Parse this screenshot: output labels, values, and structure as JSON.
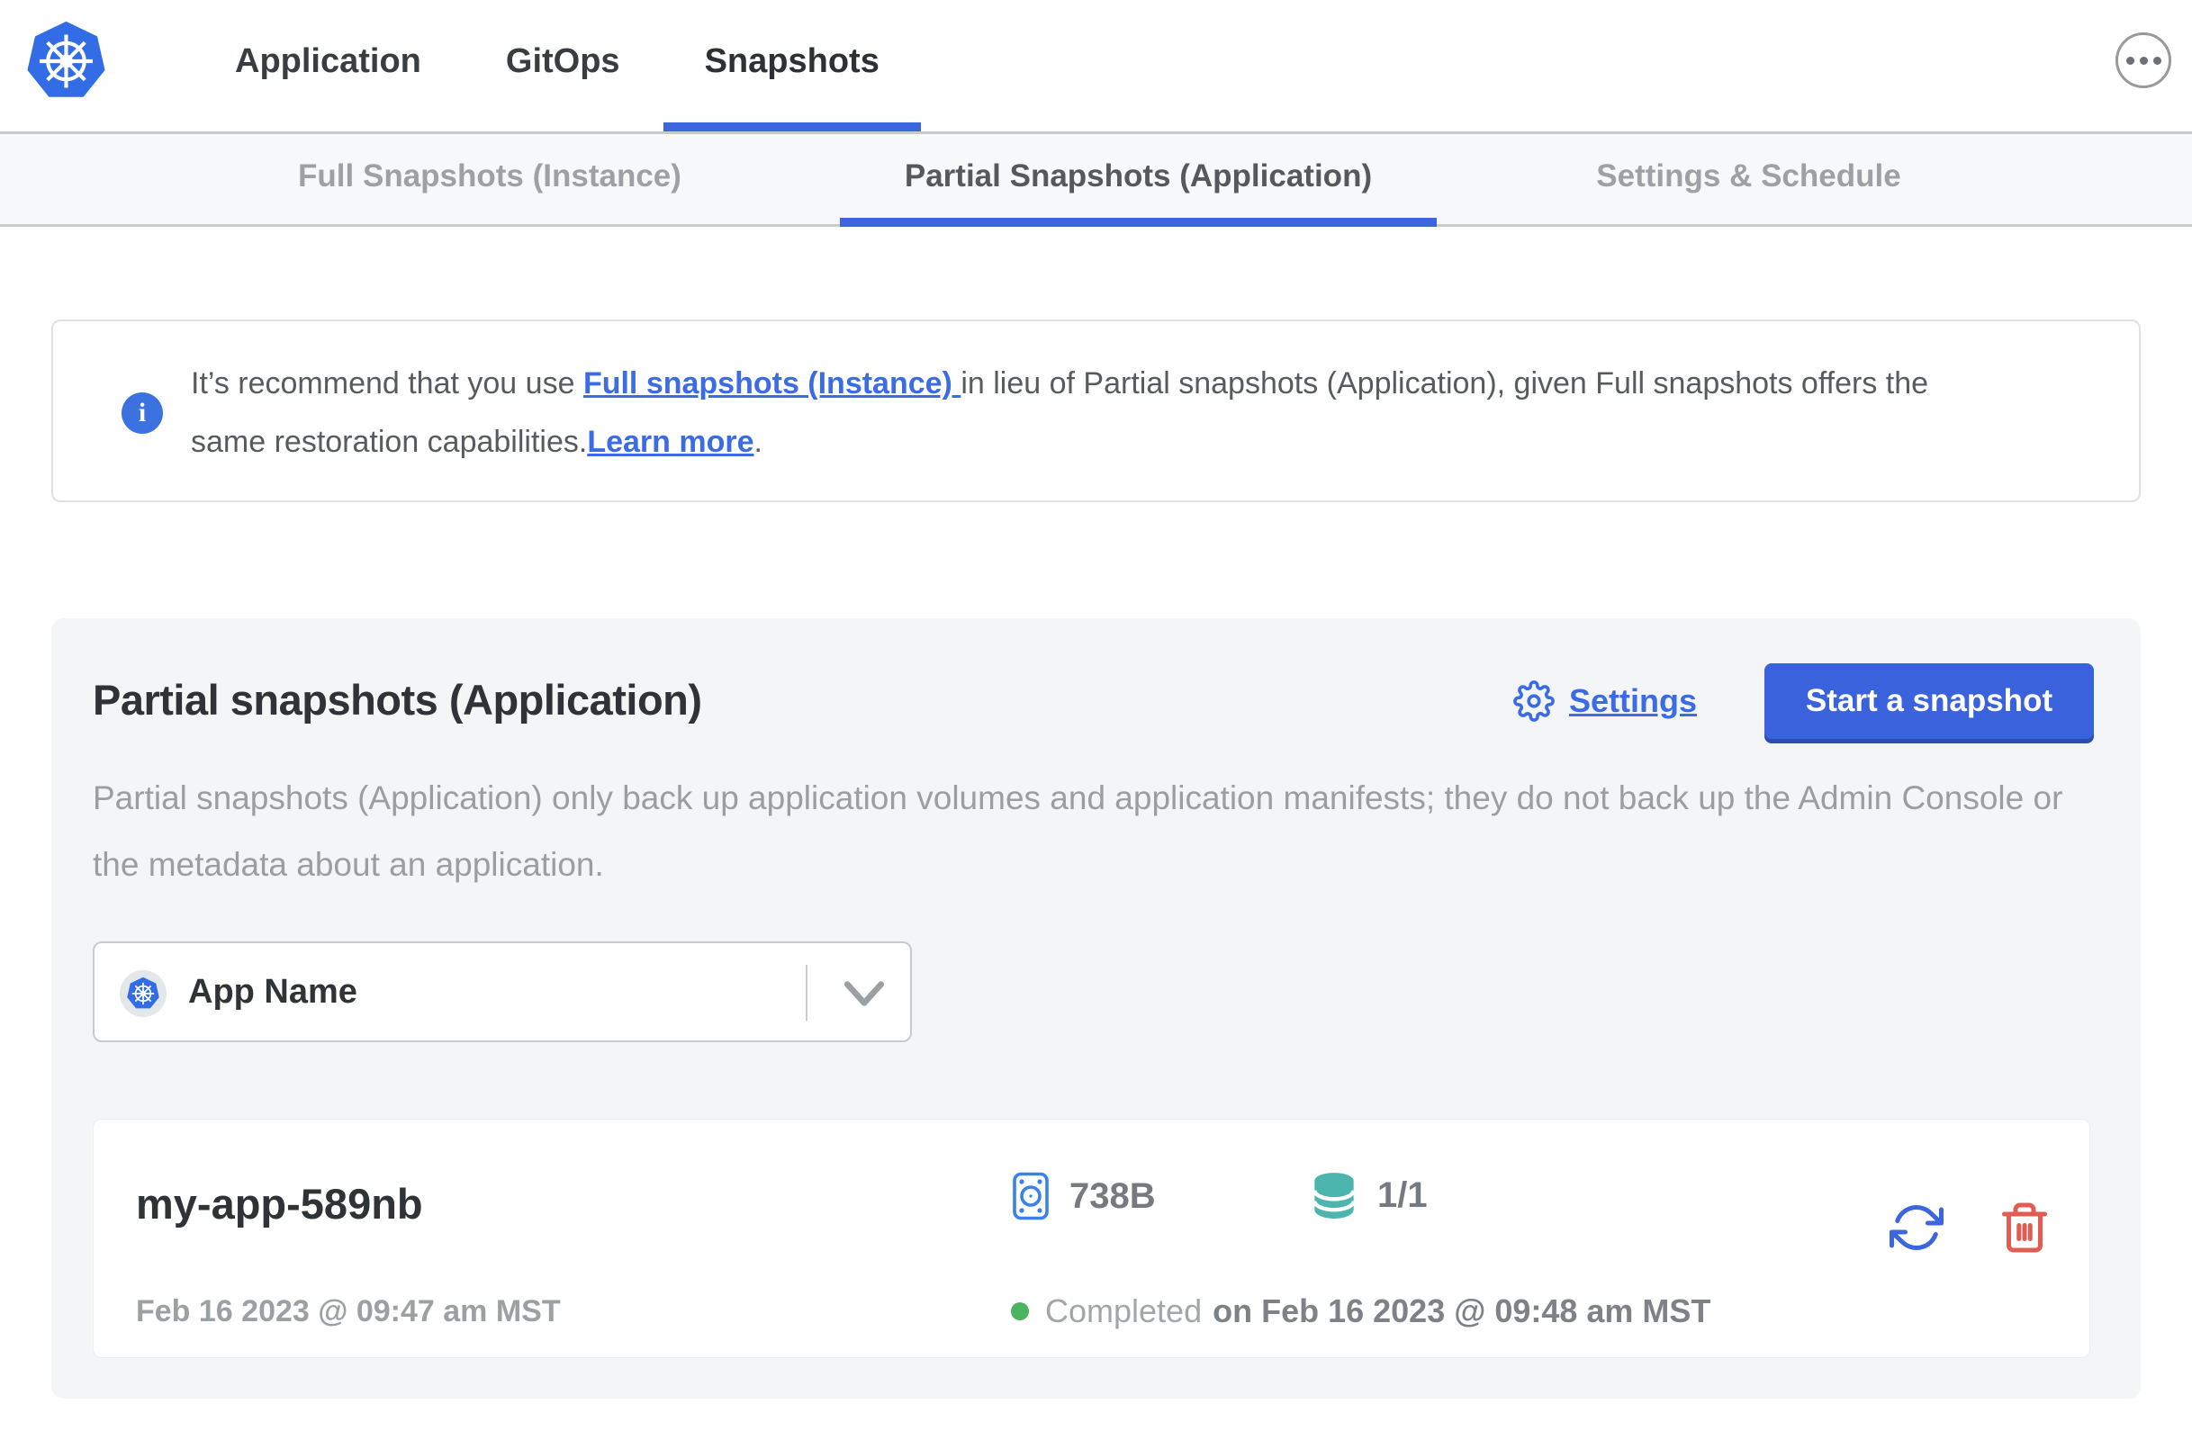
{
  "header": {
    "nav": [
      {
        "label": "Application",
        "active": false
      },
      {
        "label": "GitOps",
        "active": false
      },
      {
        "label": "Snapshots",
        "active": true
      }
    ]
  },
  "subnav": {
    "tabs": [
      {
        "label": "Full Snapshots (Instance)",
        "active": false
      },
      {
        "label": "Partial Snapshots (Application)",
        "active": true
      },
      {
        "label": "Settings & Schedule",
        "active": false
      }
    ]
  },
  "banner": {
    "text_before_link1": "It’s recommend that you use ",
    "link1": "Full snapshots (Instance) ",
    "text_after_link1": "in lieu of Partial snapshots (Application), given Full snapshots offers the",
    "line2_text": "same restoration capabilities.",
    "link2": "Learn more",
    "line2_suffix": "."
  },
  "panel": {
    "title": "Partial snapshots (Application)",
    "settings_label": "Settings",
    "start_button_label": "Start a snapshot",
    "description": "Partial snapshots (Application) only back up application volumes and application manifests; they do not back up the Admin Console or the metadata about an application.",
    "app_selector": {
      "value": "App Name"
    }
  },
  "snapshot": {
    "name": "my-app-589nb",
    "started": "Feb 16 2023 @ 09:47 am MST",
    "size": "738B",
    "volumes": "1/1",
    "status": "Completed",
    "completed_when": "on Feb 16 2023 @ 09:48 am MST"
  },
  "icons": {
    "logo": "kubernetes-logo",
    "menu": "ellipsis-menu-icon",
    "banner": "info-icon",
    "settings": "gear-icon",
    "app_selector": "kubernetes-icon, chevron-down-icon",
    "row": "hard-drive-icon, database-icon, restore-icon, trash-icon, status-dot"
  },
  "colors": {
    "accent_blue": "#3b66dd",
    "link_blue": "#3b6ce4",
    "kubernetes_blue": "#326de6",
    "panel_gray": "#f4f5f7",
    "subnav_gray": "#f7f8f9",
    "teal_database": "#4cb5ad",
    "status_green": "#4cb35f",
    "delete_red": "#e25c51",
    "text_dark": "#303336",
    "text_muted": "#9b9ea1"
  }
}
